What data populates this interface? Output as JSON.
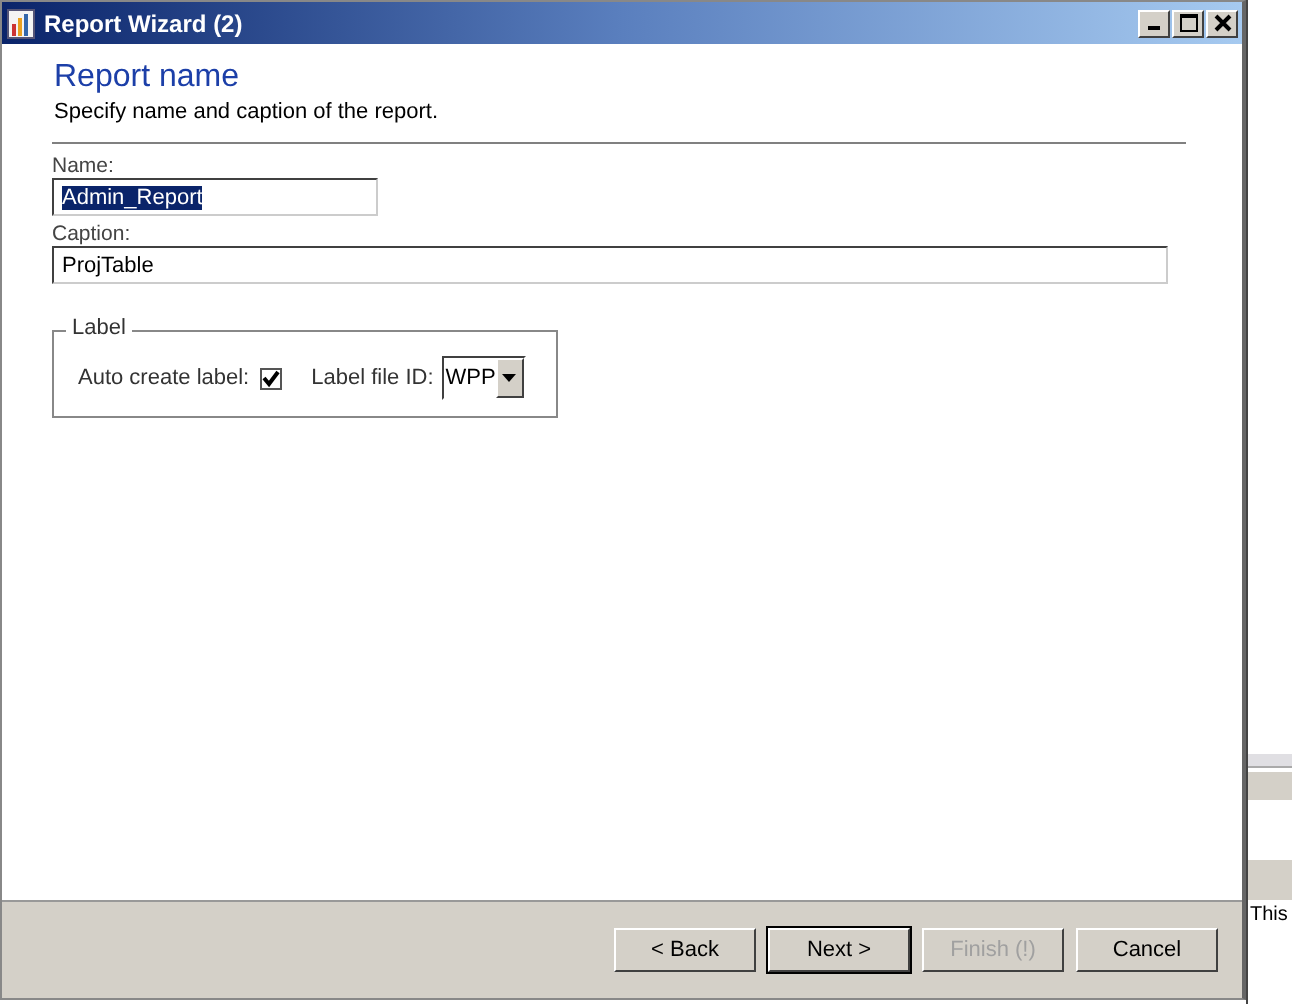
{
  "window": {
    "title": "Report Wizard (2)"
  },
  "header": {
    "title": "Report name",
    "subtitle": "Specify name and caption of the report."
  },
  "fields": [
    {
      "label": "Name:",
      "value": "Admin_Report",
      "selected": true
    },
    {
      "label": "Caption:",
      "value": "ProjTable",
      "selected": false
    }
  ],
  "label_group": {
    "title": "Label",
    "auto_create_label": {
      "label": "Auto create label:",
      "checked": true
    },
    "label_file_id": {
      "label": "Label file ID:",
      "value": "WPP"
    }
  },
  "buttons": [
    {
      "label": "< Back",
      "disabled": false,
      "default": false
    },
    {
      "label": "Next >",
      "disabled": false,
      "default": true
    },
    {
      "label": "Finish (!)",
      "disabled": true,
      "default": false
    },
    {
      "label": "Cancel",
      "disabled": false,
      "default": false
    }
  ],
  "background_window": {
    "text": "This"
  }
}
